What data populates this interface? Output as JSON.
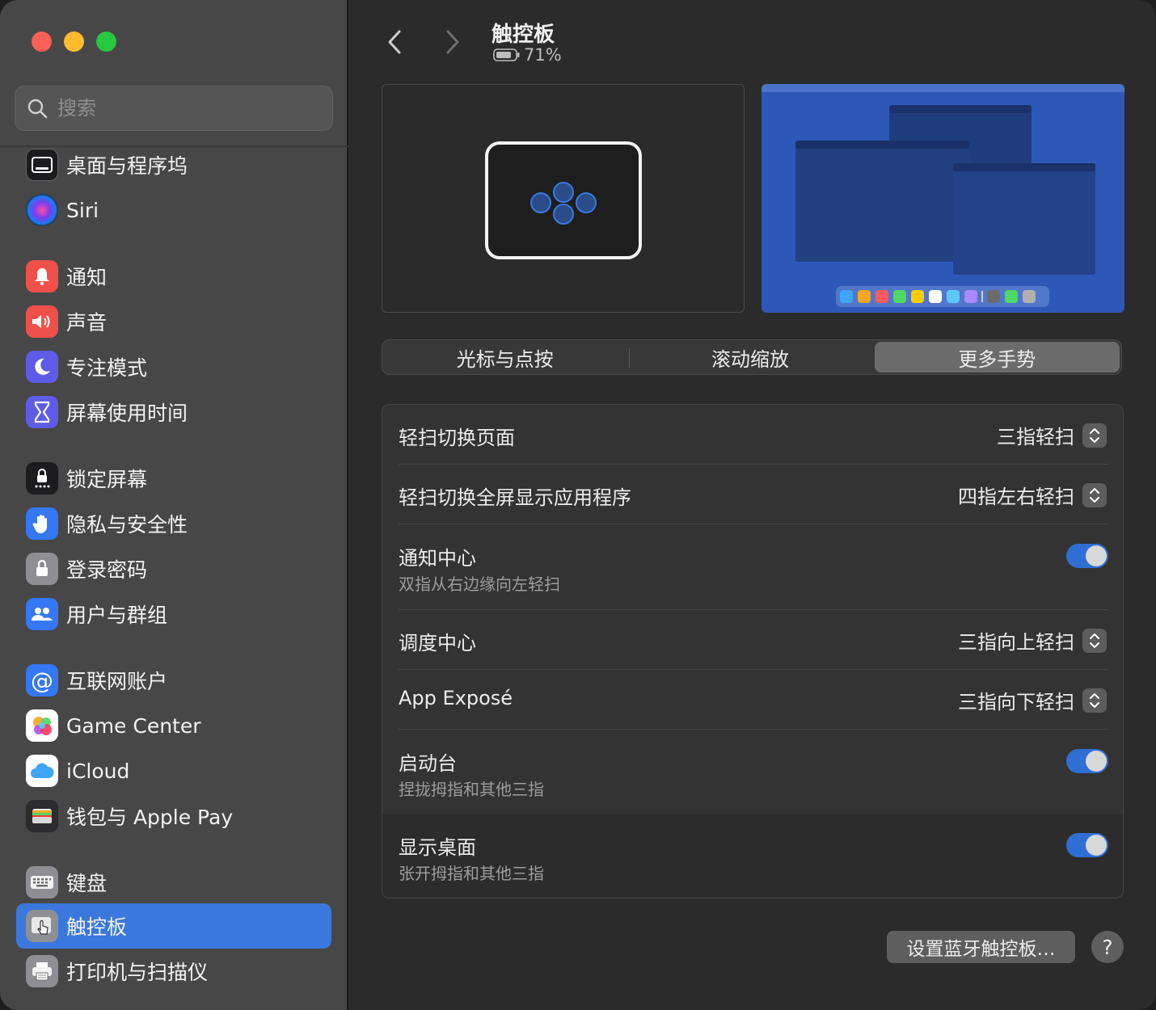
{
  "sidebar": {
    "search_placeholder": "搜索",
    "items": [
      {
        "label": "桌面与程序坞",
        "icon": "dock-icon",
        "color": "#1c1c1e"
      },
      {
        "label": "Siri",
        "icon": "siri-icon",
        "color": "#2a2a6a"
      },
      {
        "label": "通知",
        "icon": "bell-icon",
        "color": "#f0504a"
      },
      {
        "label": "声音",
        "icon": "speaker-icon",
        "color": "#f0504a"
      },
      {
        "label": "专注模式",
        "icon": "moon-icon",
        "color": "#5e5ce6"
      },
      {
        "label": "屏幕使用时间",
        "icon": "hourglass-icon",
        "color": "#5e5ce6"
      },
      {
        "label": "锁定屏幕",
        "icon": "lock-screen-icon",
        "color": "#1c1c1e"
      },
      {
        "label": "隐私与安全性",
        "icon": "hand-icon",
        "color": "#3478f6"
      },
      {
        "label": "登录密码",
        "icon": "lock-icon",
        "color": "#8e8e93"
      },
      {
        "label": "用户与群组",
        "icon": "users-icon",
        "color": "#3478f6"
      },
      {
        "label": "互联网账户",
        "icon": "at-icon",
        "color": "#3478f6"
      },
      {
        "label": "Game Center",
        "icon": "game-center-icon",
        "color": "#ffffff"
      },
      {
        "label": "iCloud",
        "icon": "cloud-icon",
        "color": "#ffffff"
      },
      {
        "label": "钱包与 Apple Pay",
        "icon": "wallet-icon",
        "color": "#2c2c2e"
      },
      {
        "label": "键盘",
        "icon": "keyboard-icon",
        "color": "#8e8e93"
      },
      {
        "label": "触控板",
        "icon": "trackpad-icon",
        "color": "#8e8e93"
      },
      {
        "label": "打印机与扫描仪",
        "icon": "printer-icon",
        "color": "#8e8e93"
      }
    ]
  },
  "header": {
    "title": "触控板",
    "battery": "71%"
  },
  "tabs": [
    "光标与点按",
    "滚动缩放",
    "更多手势"
  ],
  "selected_tab": "更多手势",
  "settings": [
    {
      "title": "轻扫切换页面",
      "value": "三指轻扫",
      "type": "popup"
    },
    {
      "title": "轻扫切换全屏显示应用程序",
      "value": "四指左右轻扫",
      "type": "popup"
    },
    {
      "title": "通知中心",
      "subtitle": "双指从右边缘向左轻扫",
      "type": "toggle",
      "on": true
    },
    {
      "title": "调度中心",
      "value": "三指向上轻扫",
      "type": "popup"
    },
    {
      "title": "App Exposé",
      "value": "三指向下轻扫",
      "type": "popup"
    },
    {
      "title": "启动台",
      "subtitle": "捏拢拇指和其他三指",
      "type": "toggle",
      "on": true
    },
    {
      "title": "显示桌面",
      "subtitle": "张开拇指和其他三指",
      "type": "toggle",
      "on": true
    }
  ],
  "footer": {
    "bluetooth_button": "设置蓝牙触控板…",
    "help_button": "?"
  },
  "colors": {
    "accent": "#3b78dd",
    "toggle_on": "#2f6fd3"
  }
}
